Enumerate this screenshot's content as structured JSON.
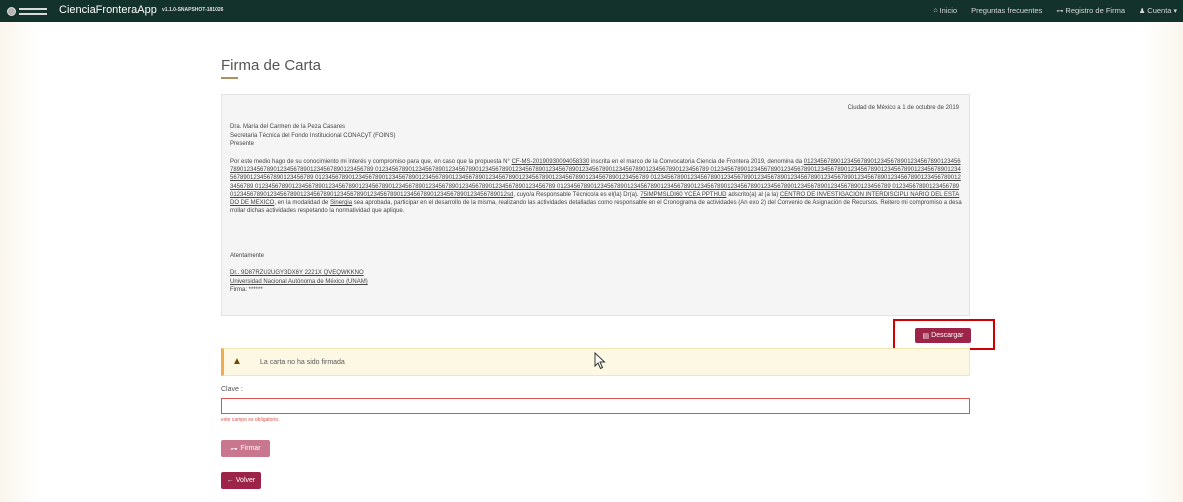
{
  "navbar": {
    "logo_text": "GOBIERNO DE MÉXICO",
    "app_title": "CienciaFronteraApp",
    "version": "v1.1.0-SNAPSHOT-181026",
    "links": [
      {
        "label": "Inicio",
        "icon": "home-icon",
        "glyph": "⌂"
      },
      {
        "label": "Preguntas frecuentes",
        "icon": "",
        "glyph": ""
      },
      {
        "label": "Registro de Firma",
        "icon": "key-icon",
        "glyph": "⊶"
      },
      {
        "label": "Cuenta",
        "icon": "user-icon",
        "glyph": "♟"
      }
    ],
    "account_caret": "▾"
  },
  "page": {
    "title": "Firma de Carta"
  },
  "letter": {
    "date": "Ciudad de México a 1 de octubre de 2019",
    "recipient_name": "Dra. María del Carmen de la Peza Casares",
    "recipient_role": "Secretaria Técnica del Fondo Institucional CONACyT (FOINS)",
    "recipient_present": "Presente",
    "body_intro": "Por este medio hago de su conocimiento mi interés y compromiso para que, en caso que la propuesta N° ",
    "proposal_id": "CF-MS-20190930094058330",
    "body_mid1": " inscrita en el marco de la Convocatoria Ciencia de Frontera 2019, denomina da ",
    "proposal_name": "012345678901234567890123456789012345678901234567890123456789012345678901234567890123456789 0123456789012345678901234567890123456789012345678901234567890123456789012345678901234567890123456789 0123456789012345678901234567890123456789012345678901234567890123456789012345678901234567890123456789 0123456789012345678901234567890123456789012345678901234567890123456789012345678901234567890123456789 0123456789012345678901234567890123456789012345678901234567890123456789012345678901234567890123456789 012345678901234567890123456789012345678901234567890123456789012345678901234567890123456789 0123456789012345678901234567890123456789012345678901234567890123456789012345678901234567890123456789 0123456789012345678901234567890123456789012345678901234567890123456789012345678901234567890123456789012sd",
    "body_mid2": ", cuyo/a Responsable Técnico/a es el(la) Dr(a). ",
    "responsible": "75IMPMSLDI60 YCEA PPTHUD",
    "body_mid3": " adscrito(a) al (a la) ",
    "institution": "CENTRO DE INVESTIGACION INTERDISCIPLI NARIO DEL ESTADO DE MEXICO",
    "body_mid4": ", en la modalidad de ",
    "modality": "Sinergia",
    "body_end": " sea aprobada, participar en el desarrollo de la misma, realizando las actividades detalladas como responsable en el Cronograma de actividades (An exo 2) del Convenio de Asignación de Recursos. Reitero mi compromiso a desarrollar dichas actividades respetando la normatividad que aplique.",
    "regards": "Atentamente",
    "signer_name": "Dr.. 9D87RZU2UGY3DX6Y 2221X QVEQWKKNO",
    "signer_university": "Universidad Nacional Autónoma de México (UNAM)",
    "signature": "Firma: ******"
  },
  "download_button": {
    "label": "Descargar",
    "icon": "file-icon"
  },
  "alert": {
    "icon": "warning-icon",
    "message": "La carta no ha sido firmada"
  },
  "form": {
    "label": "Clave :",
    "value": "",
    "error": "este campo es obligatorio."
  },
  "sign_button": {
    "label": "Firmar",
    "icon": "key-icon"
  },
  "back_button": {
    "label": "Volver",
    "icon": "arrow-left-icon"
  },
  "colors": {
    "navbar": "#13322b",
    "primary": "#9d2449",
    "accent": "#b38e5d",
    "error": "#d9534f",
    "highlight_box": "#d00000"
  }
}
